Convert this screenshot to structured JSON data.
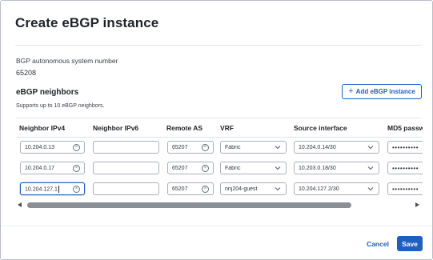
{
  "dialog": {
    "title": "Create eBGP instance",
    "asn_label": "BGP autonomous system number",
    "asn_value": "65208",
    "neighbors_title": "eBGP neighbors",
    "neighbors_subtitle": "Supports up to 10 eBGP neighbors.",
    "add_button_label": "Add eBGP instance",
    "add_button_icon": "plus-icon"
  },
  "table": {
    "columns": [
      "Neighbor IPv4",
      "Neighbor IPv6",
      "Remote AS",
      "VRF",
      "Source interface",
      "MD5 passw"
    ],
    "rows": [
      {
        "ipv4": "10.204.0.13",
        "ipv6": "",
        "remote_as": "65207",
        "vrf": "Fabric",
        "source_interface": "10.204.0.14/30",
        "md5": "••••••••••"
      },
      {
        "ipv4": "10.204.0.17",
        "ipv6": "",
        "remote_as": "65207",
        "vrf": "Fabric",
        "source_interface": "10.203.0.18/30",
        "md5": "••••••••••"
      },
      {
        "ipv4": "10.204.127.1",
        "ipv6": "",
        "remote_as": "65207",
        "vrf": "nnj204-guest",
        "source_interface": "10.204.127.2/30",
        "md5": "••••••••••"
      }
    ]
  },
  "footer": {
    "cancel_label": "Cancel",
    "save_label": "Save"
  },
  "colors": {
    "accent": "#1e5fc2",
    "border": "#aab0b8"
  }
}
